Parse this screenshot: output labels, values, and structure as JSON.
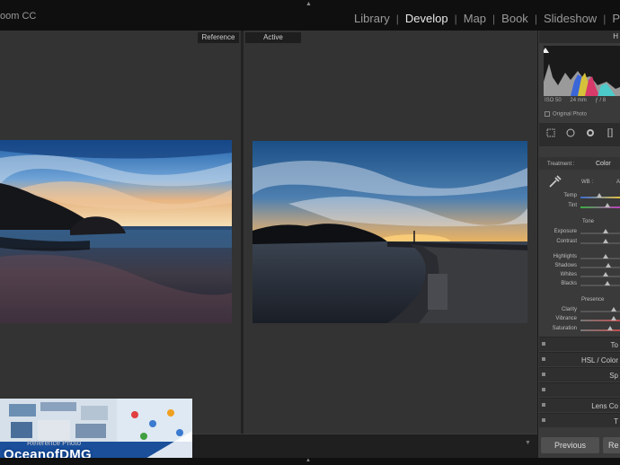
{
  "app": {
    "title": "oom CC"
  },
  "modules": [
    {
      "label": "Library",
      "active": false
    },
    {
      "label": "Develop",
      "active": true
    },
    {
      "label": "Map",
      "active": false
    },
    {
      "label": "Book",
      "active": false
    },
    {
      "label": "Slideshow",
      "active": false
    },
    {
      "label": "P",
      "active": false
    }
  ],
  "compare": {
    "reference_tag": "Reference",
    "active_tag": "Active"
  },
  "filmstrip": {
    "reference_label": "Reference Photo"
  },
  "watermark": {
    "text": "OceanofDMG"
  },
  "right_panel": {
    "histogram_header": "H",
    "camera": {
      "iso": "ISO 50",
      "focal": "24 mm",
      "aperture": "ƒ / 8"
    },
    "original_photo": "Original Photo",
    "treatment_label": "Treatment :",
    "treatment_value": "Color",
    "wb_label": "WB :",
    "wb_value": "A",
    "sliders_wb": [
      {
        "label": "Temp"
      },
      {
        "label": "Tint"
      }
    ],
    "tone_header": "Tone",
    "sliders_tone": [
      {
        "label": "Exposure"
      },
      {
        "label": "Contrast"
      }
    ],
    "sliders_tone2": [
      {
        "label": "Highlights"
      },
      {
        "label": "Shadows"
      },
      {
        "label": "Whites"
      },
      {
        "label": "Blacks"
      }
    ],
    "presence_header": "Presence",
    "sliders_presence": [
      {
        "label": "Clarity"
      },
      {
        "label": "Vibrance"
      },
      {
        "label": "Saturation"
      }
    ],
    "collapsed_panels": [
      "To",
      "HSL / Color",
      "Sp",
      "",
      "Lens Co",
      "T"
    ],
    "previous_button": "Previous",
    "reset_button": "Re"
  }
}
